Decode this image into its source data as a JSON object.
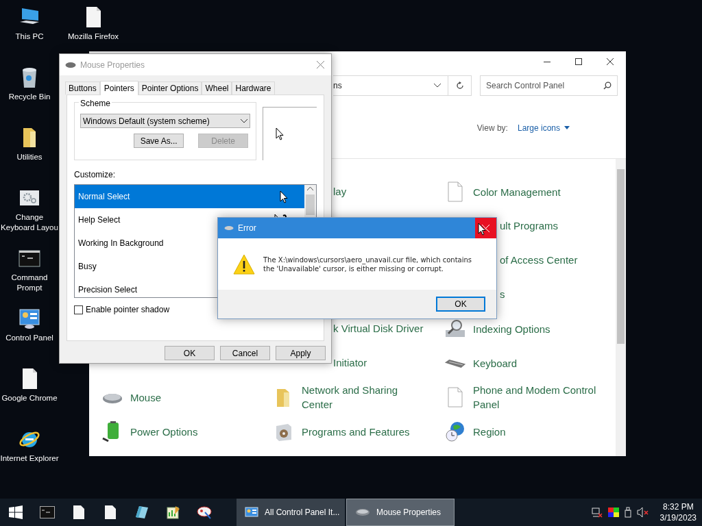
{
  "desktop_icons": [
    {
      "label": "This PC",
      "kind": "pc"
    },
    {
      "label": "Mozilla Firefox",
      "kind": "file"
    },
    {
      "label": "Recycle Bin",
      "kind": "bin"
    },
    {
      "label": "Utilities",
      "kind": "folder"
    },
    {
      "label": "Change Keyboard Layou",
      "kind": "gear"
    },
    {
      "label": "Command Prompt",
      "kind": "cmd"
    },
    {
      "label": "Control Panel",
      "kind": "panel"
    },
    {
      "label": "Google Chrome",
      "kind": "file"
    },
    {
      "label": "Internet Explorer",
      "kind": "ie"
    }
  ],
  "control_panel": {
    "address_text": "ns",
    "search": {
      "placeholder": "Search Control Panel"
    },
    "view_by": {
      "label": "View by:",
      "value": "Large icons"
    },
    "rows": [
      [
        null,
        {
          "label": "lay",
          "kind": "partial"
        },
        {
          "label": "Color Management",
          "kind": "file"
        }
      ],
      [
        null,
        null,
        {
          "label": "ult Programs",
          "kind": "partial"
        }
      ],
      [
        null,
        null,
        {
          "label": "of Access Center",
          "kind": "partial"
        }
      ],
      [
        null,
        null,
        {
          "label": "s",
          "kind": "partial"
        }
      ],
      [
        null,
        {
          "label": "k Virtual Disk Driver",
          "kind": "partial"
        },
        {
          "label": "Indexing Options",
          "kind": "search"
        }
      ],
      [
        null,
        {
          "label": "Initiator",
          "kind": "partial"
        },
        {
          "label": "Keyboard",
          "kind": "keyboard"
        }
      ],
      [
        {
          "label": "Mouse",
          "kind": "mouse"
        },
        {
          "label": "Network and Sharing Center",
          "kind": "folder"
        },
        {
          "label": "Phone and Modem Control Panel",
          "kind": "file"
        }
      ],
      [
        {
          "label": "Power Options",
          "kind": "battery"
        },
        {
          "label": "Programs and Features",
          "kind": "box"
        },
        {
          "label": "Region",
          "kind": "globe"
        }
      ]
    ]
  },
  "mouse_properties": {
    "title": "Mouse Properties",
    "tabs": [
      {
        "label": "Buttons",
        "selected": false
      },
      {
        "label": "Pointers",
        "selected": true
      },
      {
        "label": "Pointer Options",
        "selected": false
      },
      {
        "label": "Wheel",
        "selected": false
      },
      {
        "label": "Hardware",
        "selected": false
      }
    ],
    "scheme": {
      "label": "Scheme",
      "value": "Windows Default (system scheme)",
      "buttons": [
        {
          "label": "Save As...",
          "disabled": false
        },
        {
          "label": "Delete",
          "disabled": true
        }
      ]
    },
    "customize_label": "Customize:",
    "pointers": [
      {
        "name": "Normal Select",
        "selected": true
      },
      {
        "name": "Help Select",
        "selected": false
      },
      {
        "name": "Working In Background",
        "selected": false
      },
      {
        "name": "Busy",
        "selected": false
      },
      {
        "name": "Precision Select",
        "selected": false
      }
    ],
    "pointer_shadow": {
      "label": "Enable pointer shadow",
      "checked": false
    },
    "buttons": [
      "OK",
      "Cancel",
      "Apply"
    ]
  },
  "error_dialog": {
    "title": "Error",
    "message": "The X:\\windows\\cursors\\aero_unavail.cur file, which contains the 'Unavailable' cursor, is either missing or corrupt.",
    "button": "OK"
  },
  "taskbar": {
    "tasks": [
      {
        "label": "All Control Panel It...",
        "selected": false,
        "kind": "panel"
      },
      {
        "label": "Mouse Properties",
        "selected": true,
        "kind": "mouse"
      }
    ],
    "clock": {
      "time": "8:32 PM",
      "date": "3/19/2023"
    }
  }
}
